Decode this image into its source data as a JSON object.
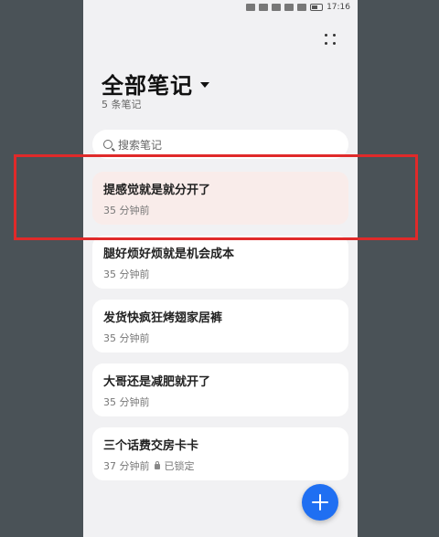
{
  "status_bar": {
    "time": "17:16"
  },
  "header": {
    "title": "全部笔记",
    "subtitle": "5 条笔记"
  },
  "search": {
    "placeholder": "搜索笔记"
  },
  "notes": [
    {
      "title": "提感觉就是就分开了",
      "time": "35 分钟前"
    },
    {
      "title": "腿好烦好烦就是机会成本",
      "time": "35 分钟前"
    },
    {
      "title": "发货快疯狂烤翅家居裤",
      "time": "35 分钟前"
    },
    {
      "title": "大哥还是减肥就开了",
      "time": "35 分钟前"
    },
    {
      "title": "三个话费交房卡卡",
      "time": "37 分钟前",
      "locked_label": "已锁定"
    }
  ],
  "colors": {
    "accent": "#1f6ff2",
    "highlight_border": "#e02a2a",
    "selected_note_bg": "#f9ecea"
  }
}
